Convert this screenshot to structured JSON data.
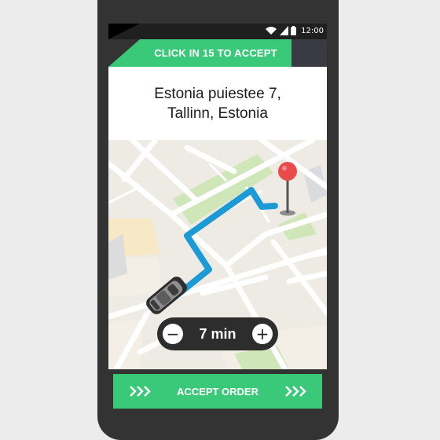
{
  "status_bar": {
    "time": "12:00",
    "icons": [
      "wifi-icon",
      "signal-icon",
      "battery-icon"
    ]
  },
  "banner": {
    "accept_countdown": "CLICK IN 15 TO ACCEPT"
  },
  "address": {
    "line1": "Estonia puiestee 7,",
    "line2": "Tallinn, Estonia"
  },
  "map": {
    "route_color": "#1c9ad6",
    "pin_color": "#e94b4b",
    "icons": [
      "car-icon",
      "destination-pin-icon"
    ]
  },
  "eta": {
    "minus": "−",
    "value": "7 min",
    "plus": "+"
  },
  "action": {
    "accept_label": "ACCEPT ORDER"
  },
  "colors": {
    "accent": "#3ac978",
    "dark": "#333333"
  }
}
